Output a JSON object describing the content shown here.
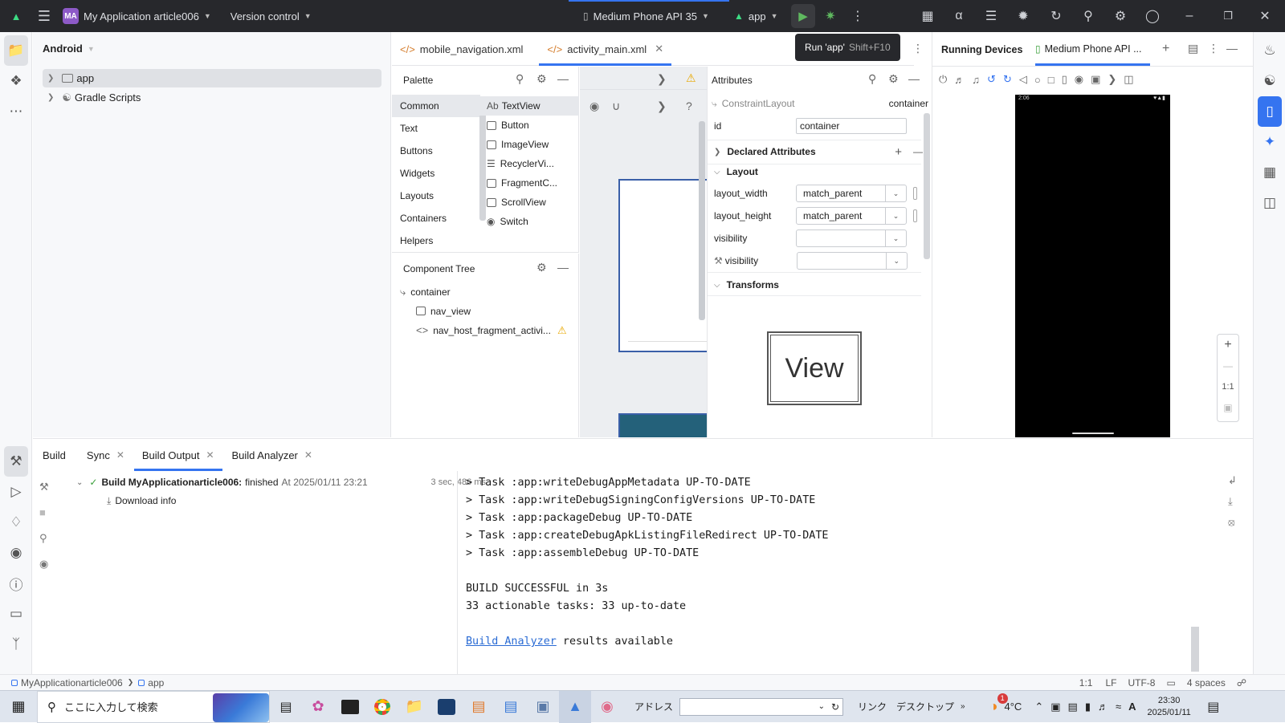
{
  "titlebar": {
    "project_badge": "MA",
    "project_name": "My Application article006",
    "version_control": "Version control",
    "device": "Medium Phone API 35",
    "run_config": "app"
  },
  "project_panel": {
    "view": "Android",
    "items": [
      "app",
      "Gradle Scripts"
    ]
  },
  "editor_tabs": [
    {
      "label": "mobile_navigation.xml"
    },
    {
      "label": "activity_main.xml"
    }
  ],
  "tooltip": {
    "label": "Run 'app'",
    "shortcut": "Shift+F10"
  },
  "palette": {
    "title": "Palette",
    "categories": [
      "Common",
      "Text",
      "Buttons",
      "Widgets",
      "Layouts",
      "Containers",
      "Helpers"
    ],
    "items": [
      {
        "prefix": "Ab",
        "label": "TextView"
      },
      {
        "label": "Button"
      },
      {
        "label": "ImageView"
      },
      {
        "label": "RecyclerVi..."
      },
      {
        "label": "FragmentC..."
      },
      {
        "label": "ScrollView"
      },
      {
        "label": "Switch"
      }
    ]
  },
  "component_tree": {
    "title": "Component Tree",
    "items": [
      "container",
      "nav_view",
      "nav_host_fragment_activi..."
    ]
  },
  "attributes": {
    "title": "Attributes",
    "component": "ConstraintLayout",
    "component_id": "container",
    "id_label": "id",
    "id_value": "container",
    "declared": "Declared Attributes",
    "layout": "Layout",
    "rows": [
      {
        "label": "layout_width",
        "value": "match_parent"
      },
      {
        "label": "layout_height",
        "value": "match_parent"
      },
      {
        "label": "visibility",
        "value": ""
      },
      {
        "label": "visibility",
        "value": ""
      }
    ],
    "transforms": "Transforms",
    "view_label": "View"
  },
  "running_devices": {
    "title": "Running Devices",
    "device_tab": "Medium Phone API ...",
    "status_time": "2:06",
    "zoom_label": "1:1"
  },
  "build": {
    "tabs": [
      "Build",
      "Sync",
      "Build Output",
      "Build Analyzer"
    ],
    "result_title": "Build MyApplicationarticle006:",
    "result_status": "finished",
    "result_time": "At 2025/01/11 23:21",
    "duration": "3 sec, 486 ms",
    "download": "Download info",
    "output_lines": [
      "> Task :app:writeDebugAppMetadata UP-TO-DATE",
      "> Task :app:writeDebugSigningConfigVersions UP-TO-DATE",
      "> Task :app:packageDebug UP-TO-DATE",
      "> Task :app:createDebugApkListingFileRedirect UP-TO-DATE",
      "> Task :app:assembleDebug UP-TO-DATE",
      "",
      "BUILD SUCCESSFUL in 3s",
      "33 actionable tasks: 33 up-to-date",
      ""
    ],
    "analyzer_link": "Build Analyzer",
    "analyzer_rest": " results available"
  },
  "statusbar": {
    "crumb1": "MyApplicationarticle006",
    "crumb2": "app",
    "pos": "1:1",
    "le": "LF",
    "enc": "UTF-8",
    "indent": "4 spaces"
  },
  "taskbar": {
    "search": "ここに入力して検索",
    "address_label": "アドレス",
    "link": "リンク",
    "desktop": "デスクトップ",
    "weather_badge": "1",
    "temp": "4°C",
    "time": "23:30",
    "date": "2025/01/11"
  },
  "colors": {
    "accent": "#3574f0",
    "success": "#3a9f3a",
    "warning": "#e9a800",
    "titlebar_bg": "#27282c"
  }
}
